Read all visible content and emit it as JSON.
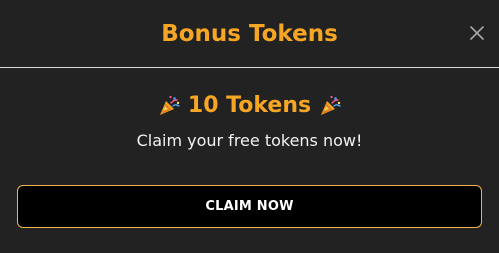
{
  "modal": {
    "title": "Bonus Tokens",
    "close_icon": "close-icon",
    "bonus_text": "10 Tokens",
    "left_icon": "party-popper-icon",
    "right_icon": "party-popper-icon",
    "subtitle": "Claim your free tokens now!",
    "button_label": "CLAIM NOW"
  },
  "colors": {
    "background": "#222222",
    "accent": "#f6a623",
    "button_border": "#f2b24a",
    "button_background": "#000000",
    "text": "#f2f2f2"
  }
}
